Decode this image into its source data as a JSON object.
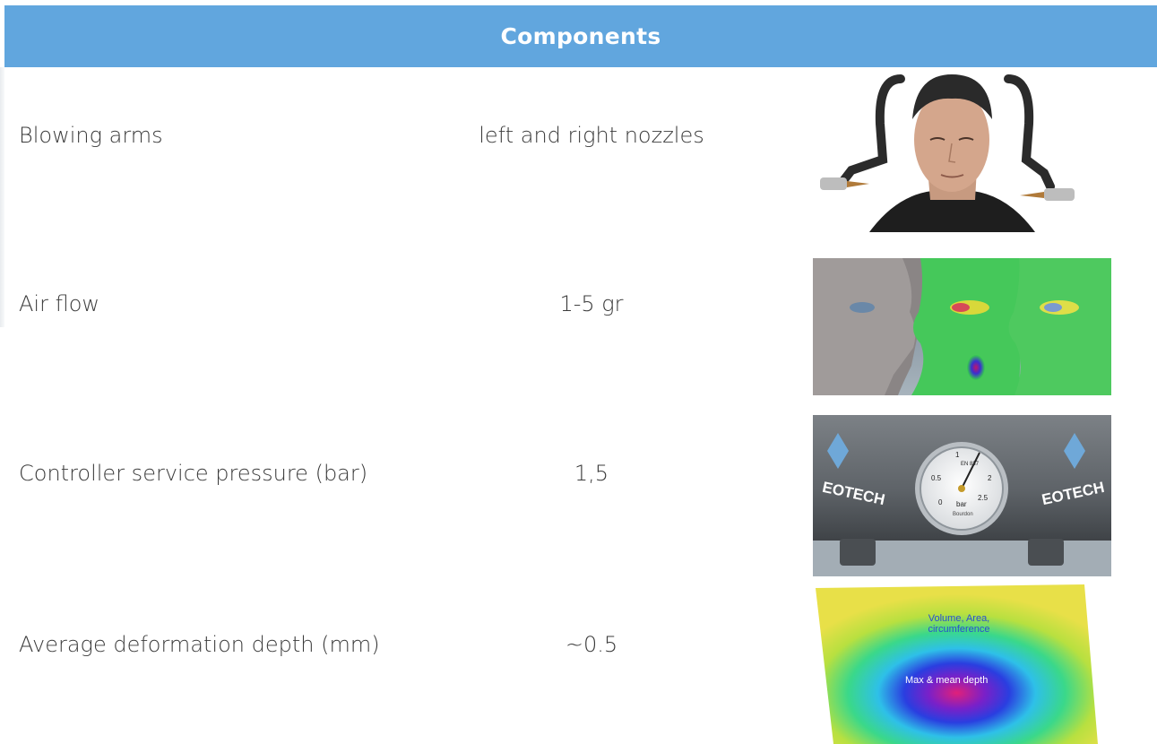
{
  "header": {
    "title": "Components"
  },
  "rows": [
    {
      "label": "Blowing arms",
      "value": "left and right nozzles",
      "image_icon": "head-device-photo"
    },
    {
      "label": "Air flow",
      "value": "1-5 gr",
      "image_icon": "face-scan-heatmap"
    },
    {
      "label": "Controller service pressure (bar)",
      "value": "1,5",
      "image_icon": "pressure-gauge-photo"
    },
    {
      "label": "Average deformation depth (mm)",
      "value": "~0.5",
      "image_icon": "deformation-heatmap"
    }
  ],
  "gauge": {
    "brand": "EOTECH",
    "unit": "bar",
    "scale": [
      "0",
      "0.5",
      "1",
      "1.5",
      "2",
      "2.5"
    ],
    "model": "EN 837",
    "maker": "Bourdon"
  },
  "deformation_labels": {
    "volume": "Volume, Area, circumference",
    "depth": "Max & mean depth"
  },
  "colors": {
    "header": "#61a6de",
    "text": "#3b3b3b"
  }
}
